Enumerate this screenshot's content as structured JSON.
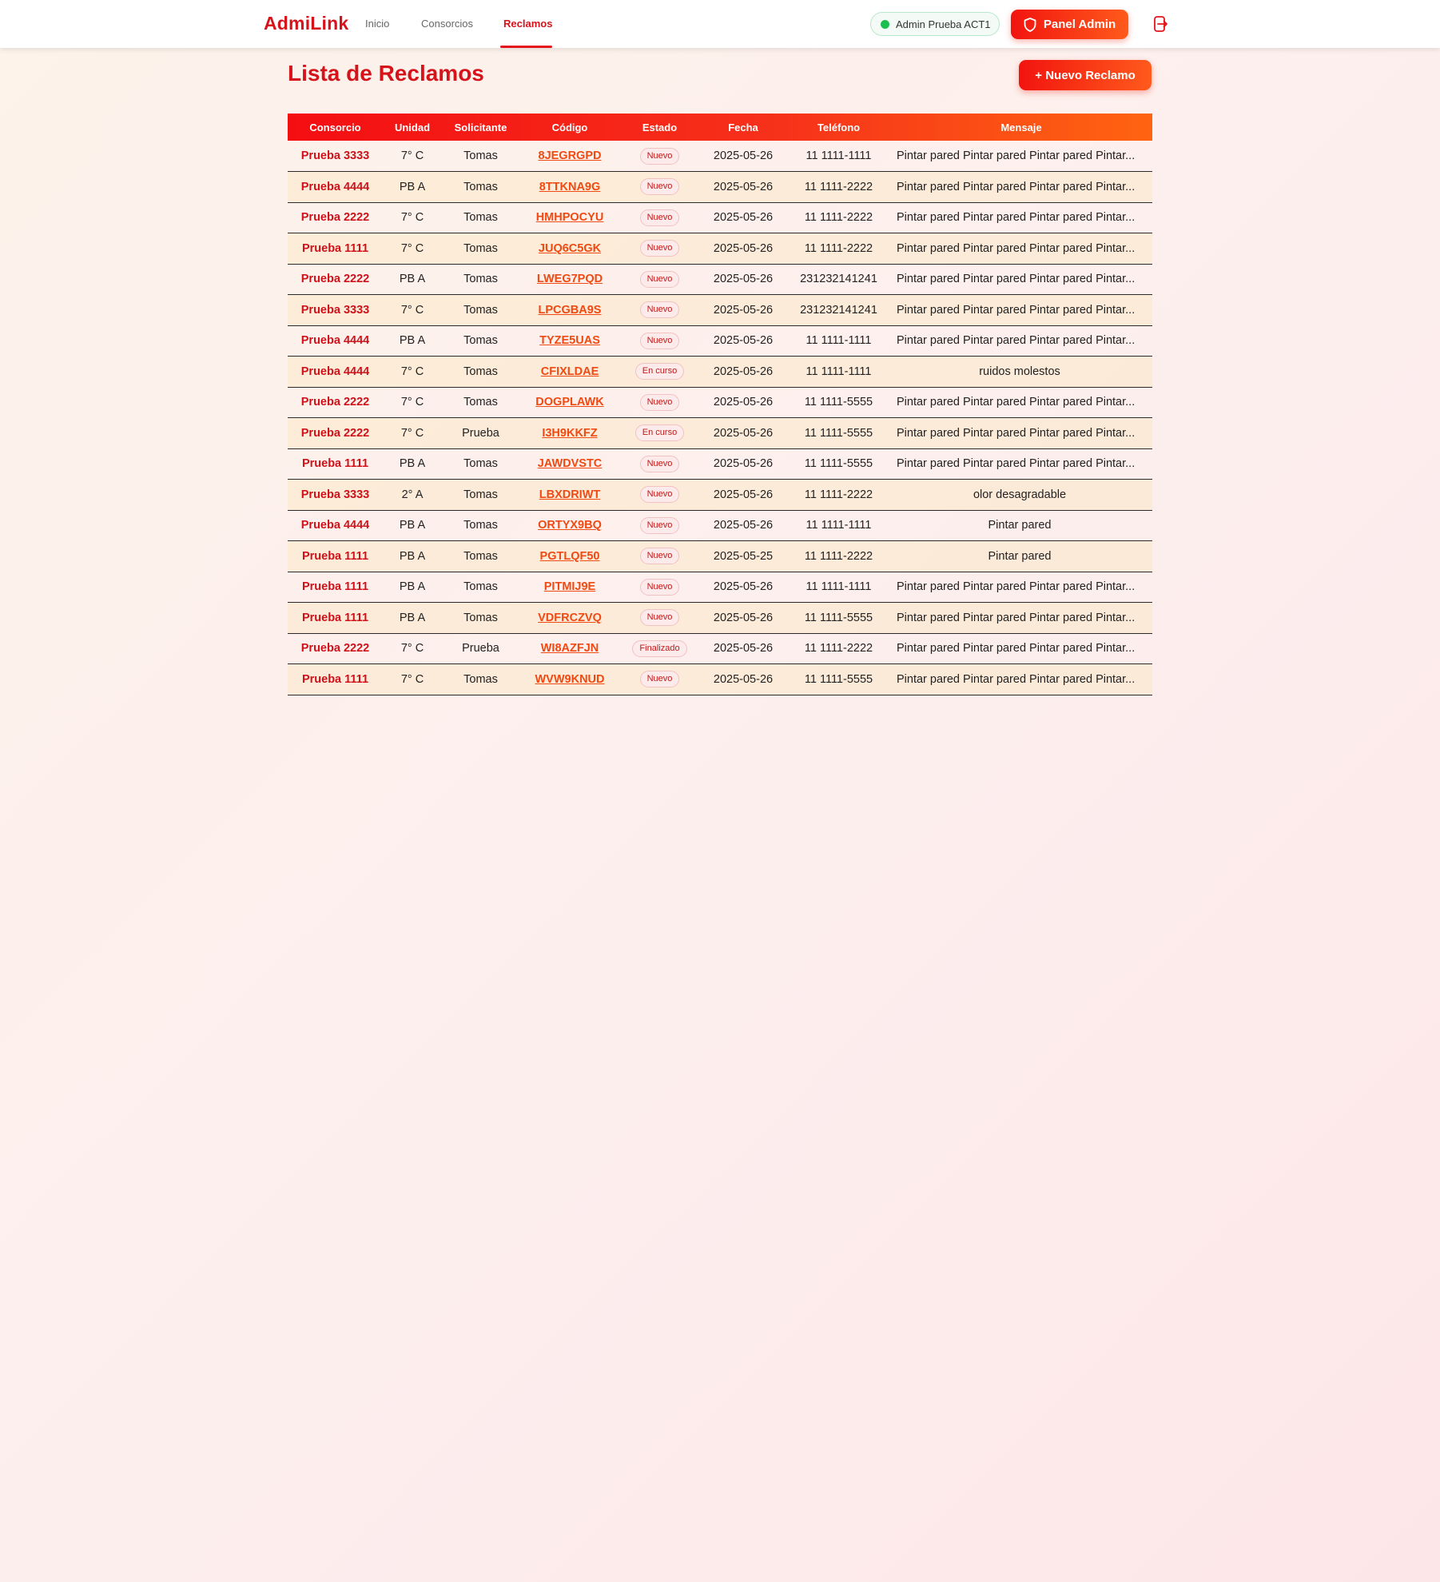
{
  "nav": {
    "brand": "AdmiLink",
    "links": [
      "Inicio",
      "Consorcios",
      "Reclamos"
    ],
    "active": "Reclamos",
    "user_label": "Admin Prueba ACT1",
    "panel_label": "Panel Admin",
    "icons": {
      "status": "online-dot",
      "panel": "shield-icon",
      "logout": "logout-icon"
    },
    "colors": {
      "brand": "#d6121a",
      "online": "#1bbf4f"
    }
  },
  "page": {
    "title": "Lista de Reclamos",
    "new_button": "+ Nuevo Reclamo"
  },
  "table": {
    "headers": [
      "Consorcio",
      "Unidad",
      "Solicitante",
      "Código",
      "Estado",
      "Fecha",
      "Teléfono",
      "Mensaje"
    ],
    "rows": [
      {
        "consorcio": "Prueba 3333",
        "unidad": "7° C",
        "solicitante": "Tomas",
        "codigo": "8JEGRGPD",
        "estado": "Nuevo",
        "fecha": "2025-05-26",
        "telefono": "11 1111-1111",
        "mensaje": "Pintar pared Pintar pared Pintar pared Pintar..."
      },
      {
        "consorcio": "Prueba 4444",
        "unidad": "PB A",
        "solicitante": "Tomas",
        "codigo": "8TTKNA9G",
        "estado": "Nuevo",
        "fecha": "2025-05-26",
        "telefono": "11 1111-2222",
        "mensaje": "Pintar pared Pintar pared Pintar pared Pintar..."
      },
      {
        "consorcio": "Prueba 2222",
        "unidad": "7° C",
        "solicitante": "Tomas",
        "codigo": "HMHPOCYU",
        "estado": "Nuevo",
        "fecha": "2025-05-26",
        "telefono": "11 1111-2222",
        "mensaje": "Pintar pared Pintar pared Pintar pared Pintar..."
      },
      {
        "consorcio": "Prueba 1111",
        "unidad": "7° C",
        "solicitante": "Tomas",
        "codigo": "JUQ6C5GK",
        "estado": "Nuevo",
        "fecha": "2025-05-26",
        "telefono": "11 1111-2222",
        "mensaje": "Pintar pared Pintar pared Pintar pared Pintar..."
      },
      {
        "consorcio": "Prueba 2222",
        "unidad": "PB A",
        "solicitante": "Tomas",
        "codigo": "LWEG7PQD",
        "estado": "Nuevo",
        "fecha": "2025-05-26",
        "telefono": "231232141241",
        "mensaje": "Pintar pared Pintar pared Pintar pared Pintar..."
      },
      {
        "consorcio": "Prueba 3333",
        "unidad": "7° C",
        "solicitante": "Tomas",
        "codigo": "LPCGBA9S",
        "estado": "Nuevo",
        "fecha": "2025-05-26",
        "telefono": "231232141241",
        "mensaje": "Pintar pared Pintar pared Pintar pared Pintar..."
      },
      {
        "consorcio": "Prueba 4444",
        "unidad": "PB A",
        "solicitante": "Tomas",
        "codigo": "TYZE5UAS",
        "estado": "Nuevo",
        "fecha": "2025-05-26",
        "telefono": "11 1111-1111",
        "mensaje": "Pintar pared Pintar pared Pintar pared Pintar..."
      },
      {
        "consorcio": "Prueba 4444",
        "unidad": "7° C",
        "solicitante": "Tomas",
        "codigo": "CFIXLDAE",
        "estado": "En curso",
        "fecha": "2025-05-26",
        "telefono": "11 1111-1111",
        "mensaje": "ruidos molestos"
      },
      {
        "consorcio": "Prueba 2222",
        "unidad": "7° C",
        "solicitante": "Tomas",
        "codigo": "DOGPLAWK",
        "estado": "Nuevo",
        "fecha": "2025-05-26",
        "telefono": "11 1111-5555",
        "mensaje": "Pintar pared Pintar pared Pintar pared Pintar..."
      },
      {
        "consorcio": "Prueba 2222",
        "unidad": "7° C",
        "solicitante": "Prueba",
        "codigo": "I3H9KKFZ",
        "estado": "En curso",
        "fecha": "2025-05-26",
        "telefono": "11 1111-5555",
        "mensaje": "Pintar pared Pintar pared Pintar pared Pintar..."
      },
      {
        "consorcio": "Prueba 1111",
        "unidad": "PB A",
        "solicitante": "Tomas",
        "codigo": "JAWDVSTC",
        "estado": "Nuevo",
        "fecha": "2025-05-26",
        "telefono": "11 1111-5555",
        "mensaje": "Pintar pared Pintar pared Pintar pared Pintar..."
      },
      {
        "consorcio": "Prueba 3333",
        "unidad": "2° A",
        "solicitante": "Tomas",
        "codigo": "LBXDRIWT",
        "estado": "Nuevo",
        "fecha": "2025-05-26",
        "telefono": "11 1111-2222",
        "mensaje": "olor desagradable"
      },
      {
        "consorcio": "Prueba 4444",
        "unidad": "PB A",
        "solicitante": "Tomas",
        "codigo": "ORTYX9BQ",
        "estado": "Nuevo",
        "fecha": "2025-05-26",
        "telefono": "11 1111-1111",
        "mensaje": "Pintar pared"
      },
      {
        "consorcio": "Prueba 1111",
        "unidad": "PB A",
        "solicitante": "Tomas",
        "codigo": "PGTLQF50",
        "estado": "Nuevo",
        "fecha": "2025-05-25",
        "telefono": "11 1111-2222",
        "mensaje": "Pintar pared"
      },
      {
        "consorcio": "Prueba 1111",
        "unidad": "PB A",
        "solicitante": "Tomas",
        "codigo": "PITMIJ9E",
        "estado": "Nuevo",
        "fecha": "2025-05-26",
        "telefono": "11 1111-1111",
        "mensaje": "Pintar pared Pintar pared Pintar pared Pintar..."
      },
      {
        "consorcio": "Prueba 1111",
        "unidad": "PB A",
        "solicitante": "Tomas",
        "codigo": "VDFRCZVQ",
        "estado": "Nuevo",
        "fecha": "2025-05-26",
        "telefono": "11 1111-5555",
        "mensaje": "Pintar pared Pintar pared Pintar pared Pintar..."
      },
      {
        "consorcio": "Prueba 2222",
        "unidad": "7° C",
        "solicitante": "Prueba",
        "codigo": "WI8AZFJN",
        "estado": "Finalizado",
        "fecha": "2025-05-26",
        "telefono": "11 1111-2222",
        "mensaje": "Pintar pared Pintar pared Pintar pared Pintar..."
      },
      {
        "consorcio": "Prueba 1111",
        "unidad": "7° C",
        "solicitante": "Tomas",
        "codigo": "WVW9KNUD",
        "estado": "Nuevo",
        "fecha": "2025-05-26",
        "telefono": "11 1111-5555",
        "mensaje": "Pintar pared Pintar pared Pintar pared Pintar..."
      }
    ]
  }
}
